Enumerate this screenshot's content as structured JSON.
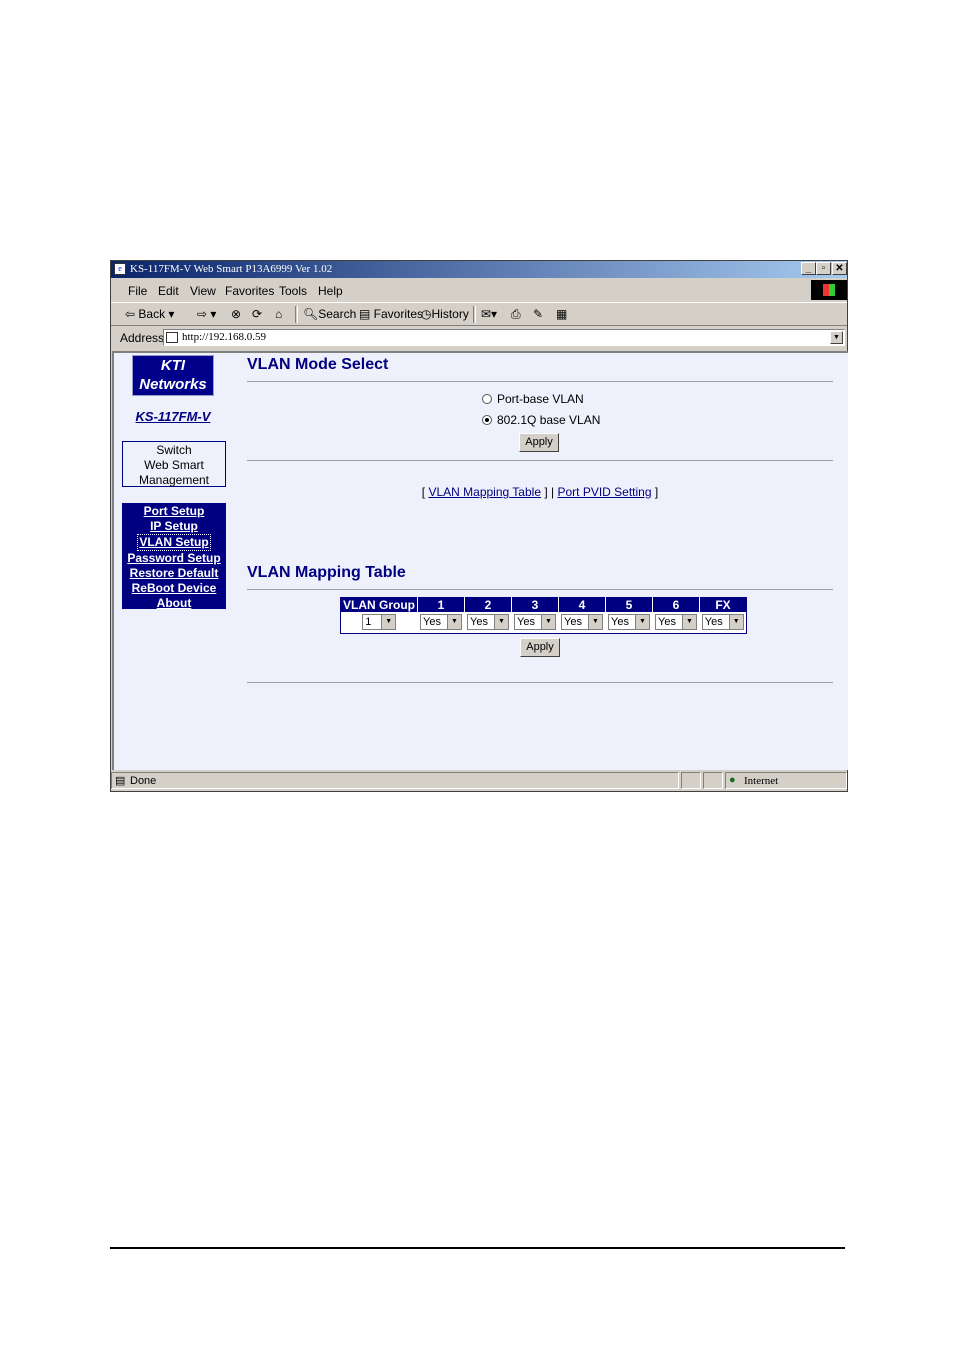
{
  "window": {
    "title": "KS-117FM-V  Web Smart P13A6999 Ver 1.02",
    "min": "_",
    "max": "▫",
    "close": "✕"
  },
  "menu": [
    "File",
    "Edit",
    "View",
    "Favorites",
    "Tools",
    "Help"
  ],
  "toolbar": {
    "back": "Back",
    "search": "Search",
    "favorites": "Favorites",
    "history": "History"
  },
  "address": {
    "label": "Address",
    "url": "http://192.168.0.59"
  },
  "sidebar": {
    "logo_line1": "KTI",
    "logo_line2": "Networks",
    "model": "KS-117FM-V",
    "box_lines": [
      "Switch",
      "Web Smart",
      "Management"
    ],
    "nav": [
      "Port Setup",
      "IP Setup",
      "VLAN Setup",
      "Password Setup",
      "Restore Default",
      "ReBoot Device",
      "About"
    ]
  },
  "vlan_mode": {
    "title": "VLAN Mode Select",
    "options": [
      "Port-base VLAN",
      "802.1Q base VLAN"
    ],
    "selected": 1,
    "apply": "Apply"
  },
  "links": {
    "open": "[",
    "mid": "] |",
    "close": "]",
    "mapping": "VLAN Mapping Table",
    "pvid": "Port PVID Setting"
  },
  "mapping": {
    "title": "VLAN Mapping Table",
    "headers": [
      "VLAN Group",
      "1",
      "2",
      "3",
      "4",
      "5",
      "6",
      "FX"
    ],
    "group_value": "1",
    "port_values": [
      "Yes",
      "Yes",
      "Yes",
      "Yes",
      "Yes",
      "Yes",
      "Yes"
    ],
    "apply": "Apply"
  },
  "status": {
    "left": "Done",
    "zone": "Internet"
  }
}
